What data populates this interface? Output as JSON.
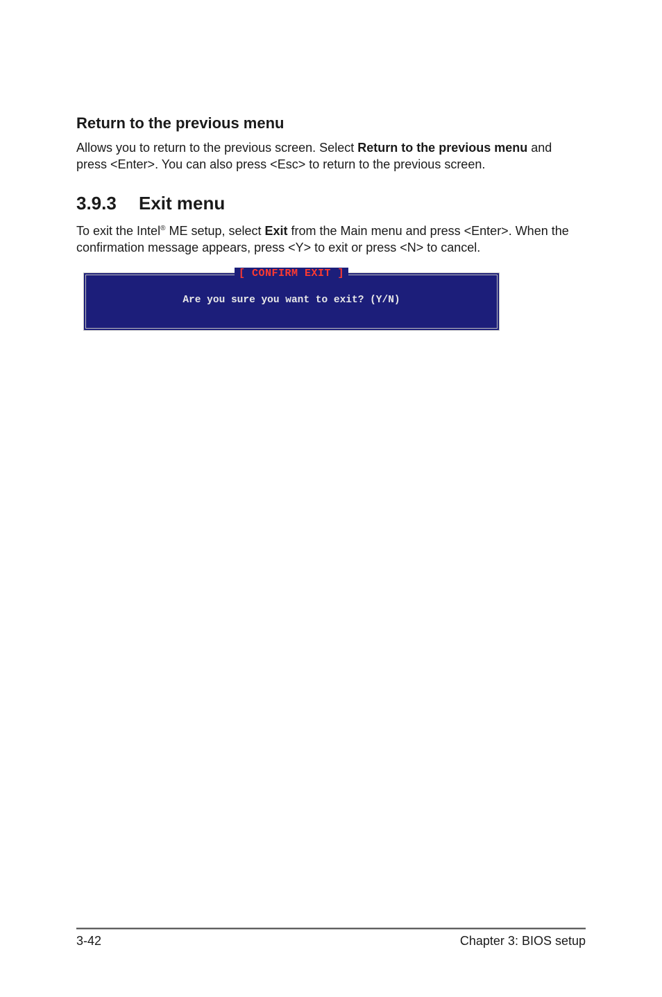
{
  "subheading": "Return to the previous menu",
  "para1_pre": "Allows you to return to the previous screen. Select ",
  "para1_bold": "Return to the previous menu",
  "para1_post": " and press <Enter>. You can also press <Esc> to return to the previous screen.",
  "section_number": "3.9.3",
  "section_title": "Exit menu",
  "para2_pre": "To exit the Intel",
  "para2_reg": "®",
  "para2_mid1": " ME setup, select ",
  "para2_bold": "Exit",
  "para2_mid2": " from the Main menu and press <Enter>. When the confirmation message appears, press <Y> to exit or press <N> to cancel.",
  "dialog": {
    "title": "[ CONFIRM EXIT ]",
    "message": "Are you sure you want to exit? (Y/N)"
  },
  "footer": {
    "left": "3-42",
    "right": "Chapter 3: BIOS setup"
  }
}
